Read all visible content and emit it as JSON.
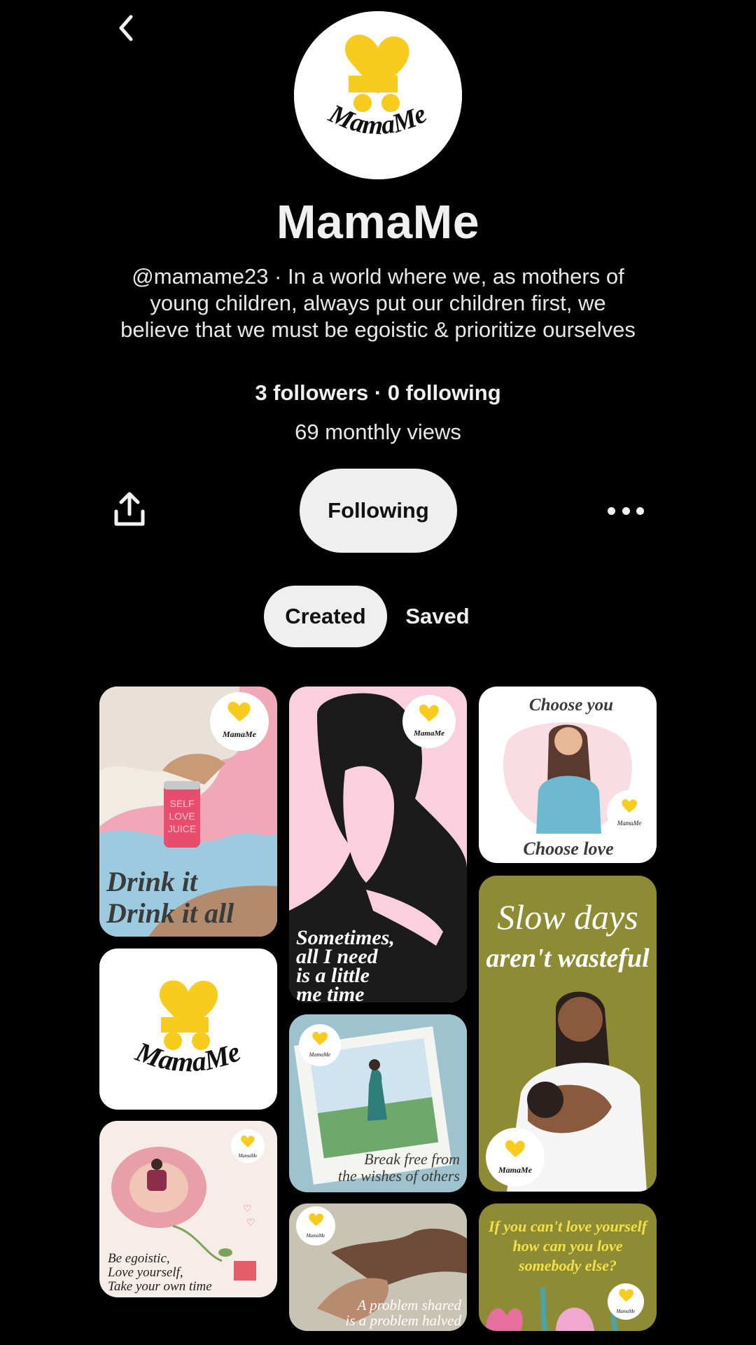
{
  "profile": {
    "name": "MamaMe",
    "bio": "@mamame23 · In a world where we, as mothers of young children, always put our children first, we believe that we must be egoistic & prioritize ourselves",
    "stats": "3 followers · 0 following",
    "views": "69 monthly views",
    "logo_text": "MamaMe"
  },
  "actions": {
    "follow_label": "Following"
  },
  "tabs": [
    {
      "label": "Created",
      "active": true
    },
    {
      "label": "Saved",
      "active": false
    }
  ],
  "pins": {
    "p1": {
      "line1": "Drink it",
      "line2": "Drink it all",
      "can1": "SELF",
      "can2": "LOVE",
      "can3": "JUICE",
      "badge": "MamaMe"
    },
    "p2": {
      "badge": "MamaMe"
    },
    "p3": {
      "l1": "Be egoistic,",
      "l2": "Love yourself,",
      "l3": "Take your own time",
      "badge": "MamaMe"
    },
    "p4": {
      "l1": "Sometimes,",
      "l2": "all I need",
      "l3": "is a little",
      "l4": "me time",
      "badge": "MamaMe"
    },
    "p5": {
      "l1": "Break free from",
      "l2": "the wishes of others",
      "badge": "MamaMe"
    },
    "p6": {
      "l1": "A problem shared",
      "l2": "is a problem halved",
      "badge": "MamaMe"
    },
    "p7": {
      "top": "Choose you",
      "bottom": "Choose love",
      "badge": "MamaMe"
    },
    "p8": {
      "l1": "Slow days",
      "l2": "aren't wasteful",
      "badge": "MamaMe"
    },
    "p9": {
      "l1": "If you can't love yourself",
      "l2": "how can you love",
      "l3": "somebody else?",
      "badge": "MamaMe"
    }
  },
  "colors": {
    "background": "#000000",
    "button_bg": "#efefef",
    "brand_yellow": "#f7cc1f"
  },
  "icons": {
    "back": "chevron-left-icon",
    "share": "share-icon",
    "more": "more-icon"
  }
}
